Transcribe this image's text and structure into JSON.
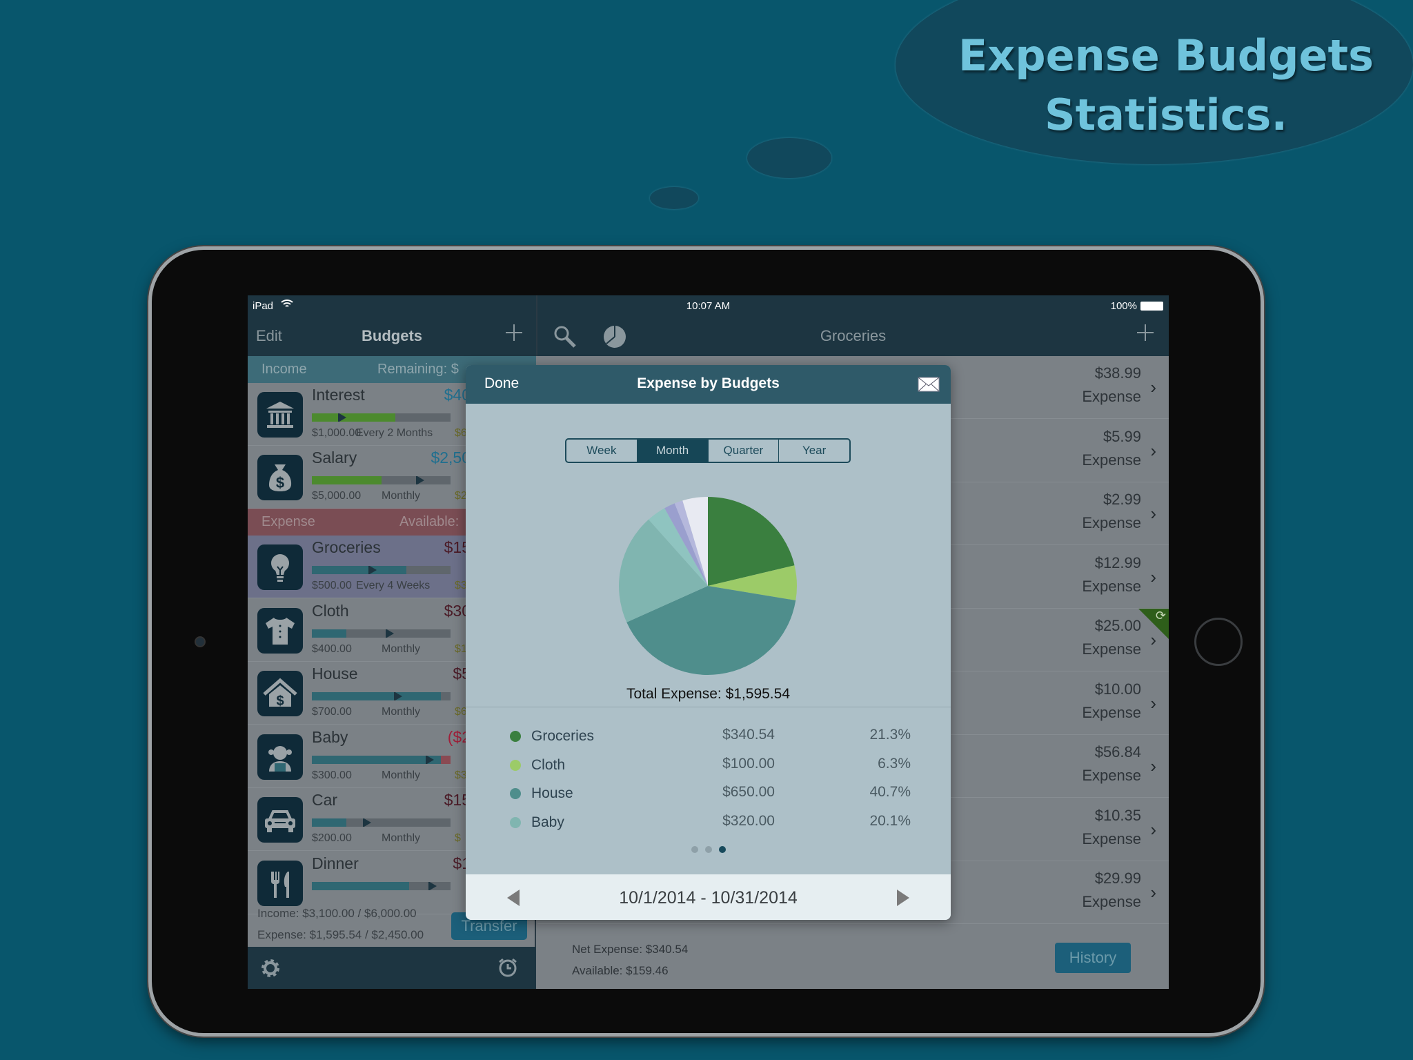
{
  "promo": {
    "line1": "Expense Budgets",
    "line2": "Statistics."
  },
  "status_bar": {
    "device": "iPad",
    "time": "10:07 AM",
    "battery": "100%"
  },
  "left_nav": {
    "edit": "Edit",
    "title": "Budgets",
    "add_icon": "plus-icon"
  },
  "income_section": {
    "label": "Income",
    "remaining": "Remaining: $"
  },
  "expense_section": {
    "label": "Expense",
    "available": "Available:"
  },
  "budgets": [
    {
      "name": "Interest",
      "amount": "$40",
      "amount_color": "#1f6f8f",
      "icon": "bank-icon",
      "budget": "$1,000.00",
      "period": "Every 2 Months",
      "extra": "$6",
      "progress": 0.6,
      "time_progress": 0.22,
      "fill_color": "#4c8a2e",
      "section": "income"
    },
    {
      "name": "Salary",
      "amount": "$2,50",
      "amount_color": "#1f6f8f",
      "icon": "money-bag-icon",
      "budget": "$5,000.00",
      "period": "Monthly",
      "extra": "$2,5",
      "progress": 0.5,
      "time_progress": 0.78,
      "fill_color": "#4c8a2e",
      "section": "income"
    },
    {
      "name": "Groceries",
      "amount": "$15",
      "amount_color": "#4a1a26",
      "icon": "lightbulb-icon",
      "budget": "$500.00",
      "period": "Every 4 Weeks",
      "extra": "$3",
      "progress": 0.68,
      "time_progress": 0.44,
      "fill_color": "#2f6772",
      "section": "expense",
      "selected": true
    },
    {
      "name": "Cloth",
      "amount": "$30",
      "amount_color": "#4a1a26",
      "icon": "shirt-icon",
      "budget": "$400.00",
      "period": "Monthly",
      "extra": "$1",
      "progress": 0.25,
      "time_progress": 0.56,
      "fill_color": "#2f6772",
      "section": "expense"
    },
    {
      "name": "House",
      "amount": "$5",
      "amount_color": "#4a1a26",
      "icon": "house-dollar-icon",
      "budget": "$700.00",
      "period": "Monthly",
      "extra": "$6",
      "progress": 0.93,
      "time_progress": 0.62,
      "fill_color": "#2f6772",
      "section": "expense"
    },
    {
      "name": "Baby",
      "amount": "($2",
      "amount_color": "#a0203a",
      "icon": "baby-icon",
      "budget": "$300.00",
      "period": "Monthly",
      "extra": "$3",
      "progress": 0.93,
      "over": true,
      "time_progress": 0.85,
      "fill_color": "#2f6772",
      "section": "expense"
    },
    {
      "name": "Car",
      "amount": "$15",
      "amount_color": "#4a1a26",
      "icon": "car-icon",
      "budget": "$200.00",
      "period": "Monthly",
      "extra": "$",
      "progress": 0.25,
      "time_progress": 0.4,
      "fill_color": "#2f6772",
      "section": "expense"
    },
    {
      "name": "Dinner",
      "amount": "$1",
      "amount_color": "#4a1a26",
      "icon": "fork-knife-icon",
      "budget": "",
      "period": "",
      "extra": "",
      "progress": 0.7,
      "time_progress": 0.87,
      "fill_color": "#2f6772",
      "section": "expense"
    }
  ],
  "summary": {
    "income": "Income: $3,100.00 / $6,000.00",
    "expense": "Expense: $1,595.54 / $2,450.00",
    "transfer": "Transfer"
  },
  "left_toolbar": {
    "settings_icon": "gear-icon",
    "reminder_icon": "alarm-clock-icon"
  },
  "right_nav": {
    "title": "Groceries",
    "search_icon": "search-icon",
    "chart_icon": "pie-chart-icon",
    "add_icon": "plus-icon"
  },
  "transactions": [
    {
      "amount": "$38.99",
      "type": "Expense"
    },
    {
      "amount": "$5.99",
      "type": "Expense"
    },
    {
      "amount": "$2.99",
      "type": "Expense"
    },
    {
      "amount": "$12.99",
      "type": "Expense"
    },
    {
      "amount": "$25.00",
      "type": "Expense",
      "recurring": true
    },
    {
      "amount": "$10.00",
      "type": "Expense"
    },
    {
      "amount": "$56.84",
      "type": "Expense"
    },
    {
      "amount": "$10.35",
      "type": "Expense"
    },
    {
      "amount": "$29.99",
      "type": "Expense"
    }
  ],
  "right_footer": {
    "net_expense": "Net Expense: $340.54",
    "available": "Available: $159.46",
    "history": "History"
  },
  "popover": {
    "done": "Done",
    "title": "Expense by Budgets",
    "mail_icon": "envelope-icon",
    "periods": [
      "Week",
      "Month",
      "Quarter",
      "Year"
    ],
    "selected_period": "Month",
    "total": "Total Expense: $1,595.54",
    "page_count": 3,
    "current_page": 3,
    "date_range": "10/1/2014 - 10/31/2014",
    "prev_icon": "triangle-left-icon",
    "next_icon": "triangle-right-icon"
  },
  "chart_data": {
    "type": "pie",
    "title": "Expense by Budgets",
    "start": "top-clockwise",
    "slices": [
      {
        "name": "Groceries",
        "value": 340.54,
        "percent": 21.3,
        "amount": "$340.54",
        "percent_label": "21.3%",
        "color": "#3a7f3f"
      },
      {
        "name": "Cloth",
        "value": 100.0,
        "percent": 6.3,
        "amount": "$100.00",
        "percent_label": "6.3%",
        "color": "#9ccb68"
      },
      {
        "name": "House",
        "value": 650.0,
        "percent": 40.7,
        "amount": "$650.00",
        "percent_label": "40.7%",
        "color": "#4f8e8c"
      },
      {
        "name": "Baby",
        "value": 320.0,
        "percent": 20.1,
        "amount": "$320.00",
        "percent_label": "20.1%",
        "color": "#80b5b0"
      },
      {
        "percent": 3.5,
        "color": "#8fc4c0"
      },
      {
        "percent": 2.0,
        "color": "#9a9fce"
      },
      {
        "percent": 1.5,
        "color": "#b5b8dc"
      },
      {
        "percent": 4.6,
        "color": "#e8eaf2"
      }
    ]
  }
}
